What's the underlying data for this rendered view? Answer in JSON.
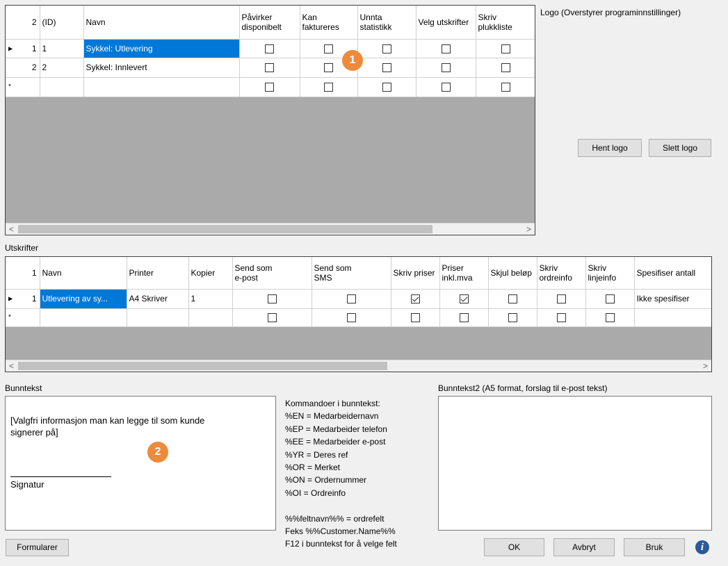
{
  "logo": {
    "label": "Logo (Overstyrer programinnstillinger)",
    "fetch_button": "Hent logo",
    "delete_button": "Slett logo"
  },
  "types_grid": {
    "row_count": "2",
    "columns": [
      "(ID)",
      "Navn",
      "Påvirker disponibelt",
      "Kan faktureres",
      "Unnta statistikk",
      "Velg utskrifter",
      "Skriv plukkliste"
    ],
    "rows": [
      {
        "num": "1",
        "id": "1",
        "name": "Sykkel: Utlevering",
        "checks": [
          false,
          false,
          false,
          false,
          false
        ]
      },
      {
        "num": "2",
        "id": "2",
        "name": "Sykkel: Innlevert",
        "checks": [
          false,
          false,
          false,
          false,
          false
        ]
      }
    ],
    "new_row_checks": [
      false,
      false,
      false,
      false,
      false
    ]
  },
  "prints": {
    "label": "Utskrifter",
    "row_count": "1",
    "columns": [
      "Navn",
      "Printer",
      "Kopier",
      "Send som e-post",
      "Send som SMS",
      "Skriv priser",
      "Priser inkl.mva",
      "Skjul beløp",
      "Skriv ordreinfo",
      "Skriv linjeinfo",
      "Spesifiser antall"
    ],
    "rows": [
      {
        "num": "1",
        "name": "Utlevering av sy...",
        "printer": "A4 Skriver",
        "copies": "1",
        "checks": [
          false,
          false,
          true,
          true,
          false,
          false,
          false
        ],
        "spec": "Ikke spesifiser"
      }
    ],
    "new_row_checks": [
      false,
      false,
      false,
      false,
      false,
      false,
      false
    ]
  },
  "footer": {
    "label": "Bunntekst",
    "text_line1": "[Valgfri informasjon man kan legge til som kunde",
    "text_line2": "signerer på]",
    "signature": "Signatur",
    "commands": [
      "Kommandoer i bunntekst:",
      "%EN = Medarbeidernavn",
      "%EP = Medarbeider telefon",
      "%EE = Medarbeider e-post",
      "%YR = Deres ref",
      "%OR = Merket",
      "%ON = Ordernummer",
      "%OI = Ordreinfo",
      "",
      "%%feltnavn%% = ordrefelt",
      "Feks %%Customer.Name%%",
      "F12 i bunntekst  for å velge felt"
    ]
  },
  "footer2": {
    "label": "Bunntekst2 (A5 format, forslag til e-post tekst)"
  },
  "buttons": {
    "forms": "Formularer",
    "ok": "OK",
    "cancel": "Avbryt",
    "apply": "Bruk"
  },
  "badges": {
    "one": "1",
    "two": "2"
  },
  "colors": {
    "selection": "#0078d7",
    "badge": "#ef8a3a",
    "info": "#2c5a96"
  }
}
